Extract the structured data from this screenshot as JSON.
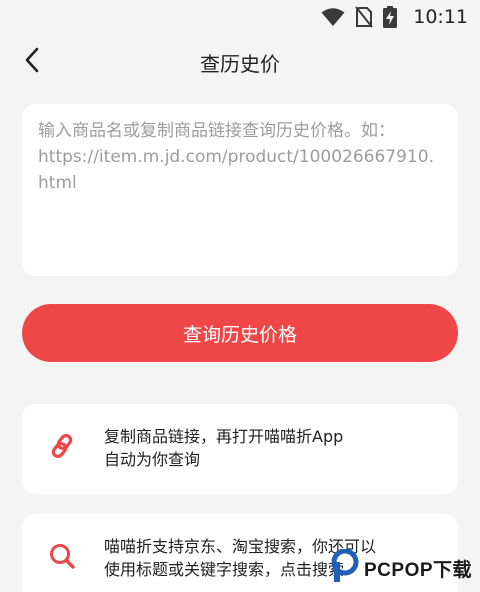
{
  "status_bar": {
    "time": "10:11",
    "icons": [
      "wifi-icon",
      "no-sim-icon",
      "battery-charging-icon"
    ]
  },
  "header": {
    "back_icon": "chevron-left-icon",
    "title": "查历史价"
  },
  "query": {
    "placeholder": "输入商品名或复制商品链接查询历史价格。如：https://item.m.jd.com/product/100026667910.html",
    "value": ""
  },
  "query_button": {
    "label": "查询历史价格"
  },
  "tips": [
    {
      "icon": "link-icon",
      "lines": [
        "复制商品链接，再打开喵喵折App",
        "自动为你查询"
      ]
    },
    {
      "icon": "search-icon",
      "lines": [
        "喵喵折支持京东、淘宝搜索，你还可以",
        "使用标题或关键字搜索，点击搜索"
      ]
    }
  ],
  "watermark": {
    "text": "PCPOP下载"
  },
  "colors": {
    "accent": "#ef4747",
    "background": "#f4f4f4",
    "card": "#ffffff",
    "placeholder": "#9c9c9c"
  }
}
